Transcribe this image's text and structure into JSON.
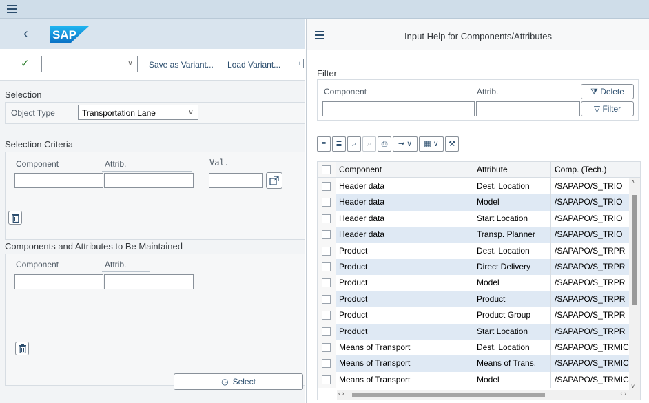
{
  "left": {
    "toolbar": {
      "save_variant": "Save as Variant...",
      "load_variant": "Load Variant...",
      "variant_value": ""
    },
    "selection": {
      "title": "Selection",
      "object_type_label": "Object Type",
      "object_type_value": "Transportation Lane"
    },
    "criteria": {
      "title": "Selection Criteria",
      "component_label": "Component",
      "attrib_label": "Attrib.",
      "val_label": "Val."
    },
    "maintain": {
      "title": "Components and Attributes to Be Maintained",
      "component_label": "Component",
      "attrib_label": "Attrib."
    },
    "select_button": "Select"
  },
  "dialog": {
    "title": "Input Help for Components/Attributes",
    "filter_label": "Filter",
    "component_label": "Component",
    "attrib_label": "Attrib.",
    "delete_button": "Delete",
    "filter_button": "Filter",
    "columns": [
      "Component",
      "Attribute",
      "Comp. (Tech.)"
    ],
    "rows": [
      [
        "Header data",
        "Dest. Location",
        "/SAPAPO/S_TRIO"
      ],
      [
        "Header data",
        "Model",
        "/SAPAPO/S_TRIO"
      ],
      [
        "Header data",
        "Start Location",
        "/SAPAPO/S_TRIO"
      ],
      [
        "Header data",
        "Transp. Planner",
        "/SAPAPO/S_TRIO"
      ],
      [
        "Product",
        "Dest. Location",
        "/SAPAPO/S_TRPR"
      ],
      [
        "Product",
        "Direct Delivery",
        "/SAPAPO/S_TRPR"
      ],
      [
        "Product",
        "Model",
        "/SAPAPO/S_TRPR"
      ],
      [
        "Product",
        "Product",
        "/SAPAPO/S_TRPR"
      ],
      [
        "Product",
        "Product Group",
        "/SAPAPO/S_TRPR"
      ],
      [
        "Product",
        "Start Location",
        "/SAPAPO/S_TRPR"
      ],
      [
        "Means of Transport",
        "Dest. Location",
        "/SAPAPO/S_TRMIC"
      ],
      [
        "Means of Transport",
        "Means of Trans.",
        "/SAPAPO/S_TRMIC"
      ],
      [
        "Means of Transport",
        "Model",
        "/SAPAPO/S_TRMIC"
      ]
    ]
  }
}
